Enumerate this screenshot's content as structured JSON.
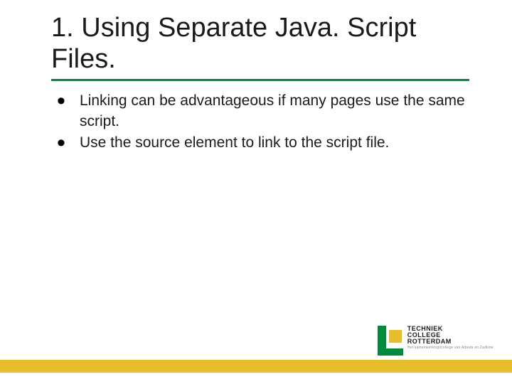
{
  "title": "1.  Using Separate Java. Script Files.",
  "bullets": [
    "Linking can be advantageous if many pages use the same script.",
    "Use the source element to link to the script file."
  ],
  "logo": {
    "line1": "TECHNIEK",
    "line2": "COLLEGE",
    "line3": "ROTTERDAM",
    "sub": "Het samenwerkingscollege van Albeda en Zadkine"
  }
}
